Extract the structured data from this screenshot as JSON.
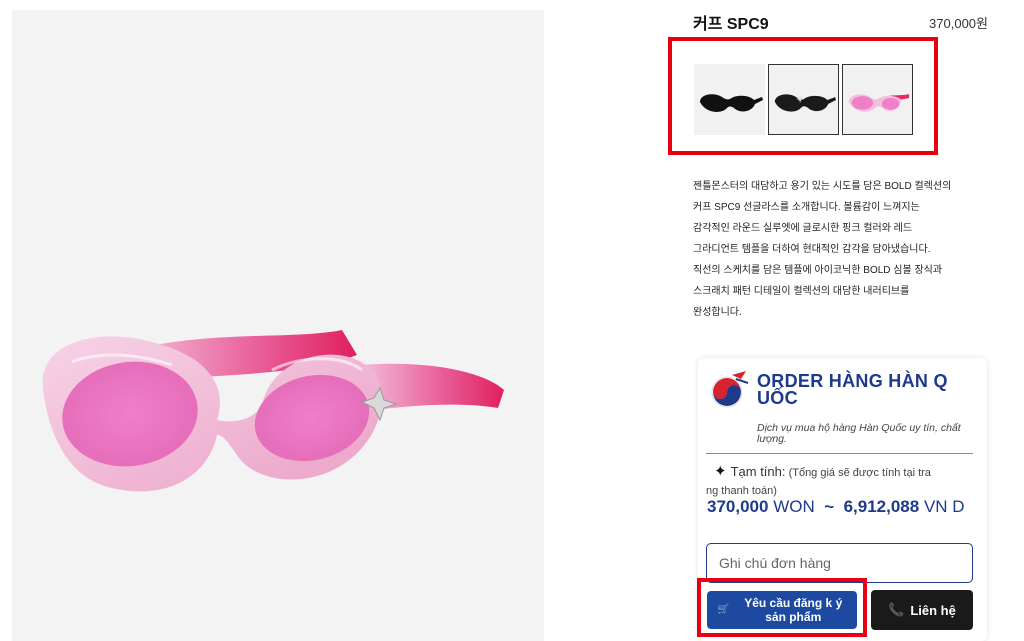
{
  "product": {
    "title": "커프 SPC9",
    "price": "370,000원",
    "image_icon": "sunglasses-pink-image"
  },
  "variants": [
    {
      "name": "black-sunglasses",
      "color": "#111111"
    },
    {
      "name": "black-silver-sunglasses",
      "color": "#1a1a1a"
    },
    {
      "name": "pink-sunglasses",
      "color": "#f5a3d0"
    }
  ],
  "description": [
    "젠틀몬스터의 대담하고 용기 있는 시도를 담은 BOLD 컬렉션의",
    "커프 SPC9 선글라스를 소개합니다. 볼륨감이 느껴지는",
    "감각적인 라운드 실루엣에 글로시한 핑크 컬러와 레드",
    "그라디언트 템플을 더하여 현대적인 감각을 담아냈습니다.",
    "직선의 스케치를 담은 템플에 아이코닉한 BOLD 심볼 장식과",
    "스크래치 패턴 디테일이 컬렉션의 대담한 내러티브를",
    "완성합니다."
  ],
  "order": {
    "title": "ORDER HÀNG HÀN Q UỐC",
    "subtitle": "Dịch vụ mua hộ hàng Hàn Quốc uy tín, chất lượng.",
    "estimate_label": "Tạm tính:",
    "estimate_note": "(Tổng giá sẽ được tính tại tra",
    "estimate_note_cont": "ng thanh toán)",
    "price_won": "370,000",
    "won_unit": "WON",
    "tilde": "~",
    "price_vnd": "6,912,088",
    "vnd_unit": "VN D",
    "note_placeholder": "Ghi chú đơn hàng",
    "register_label": "Yêu cầu đăng k ý sản phẩm",
    "contact_label": "Liên hệ"
  },
  "colors": {
    "accent_blue": "#1e3a8a",
    "button_blue": "#1d4aa0",
    "highlight_red": "#e60012",
    "contact_dark": "#1a1a1a"
  }
}
